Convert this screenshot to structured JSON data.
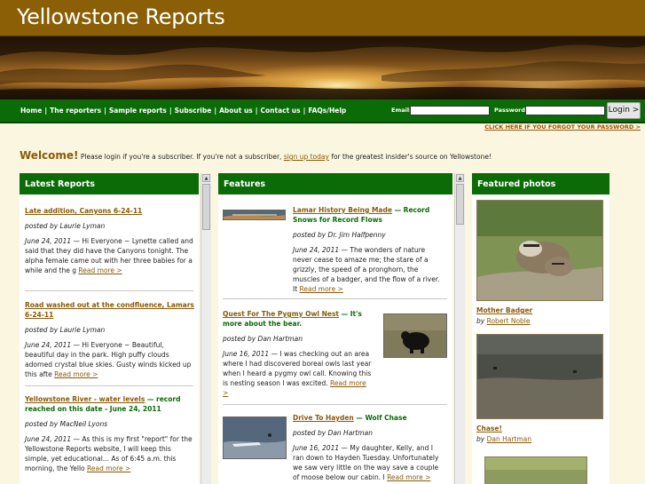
{
  "site": {
    "title": "Yellowstone Reports"
  },
  "nav": {
    "items": [
      "Home",
      "The reporters",
      "Sample reports",
      "Subscribe",
      "About us",
      "Contact us",
      "FAQs/Help"
    ],
    "separator": "|"
  },
  "login": {
    "email_label": "Email:",
    "password_label": "Password:",
    "email_value": "",
    "password_value": "",
    "button_label": "Login >",
    "forgot_link": "CLICK HERE IF YOU FORGOT YOUR PASSWORD >"
  },
  "welcome": {
    "heading": "Welcome!",
    "text_before": " Please login if you're a subscriber. If you're not a subscriber, ",
    "link": "sign up today",
    "text_after": " for the greatest insider's source on Yellowstone!"
  },
  "latest_reports": {
    "heading": "Latest Reports",
    "read_more": "Read more >",
    "items": [
      {
        "title": "Late addition, Canyons 6-24-11",
        "subtitle": "",
        "by": "posted by Laurie Lyman",
        "date": "June 24, 2011",
        "text": " — Hi Everyone ~ Lynette called and said that they did have the Canyons tonight. The alpha female came out with her three babies for a while and the g "
      },
      {
        "title": "Road washed out at the condfluence, Lamars 6-24-11",
        "subtitle": "",
        "by": "posted by Laurie Lyman",
        "date": "June 24, 2011",
        "text": " — Hi Everyone ~  Beautiful, beautiful day in the park.  High puffy clouds adorned crystal blue skies.  Gusty winds kicked up this afte "
      },
      {
        "title": "Yellowstone River - water levels",
        "subtitle": " — record reached on this date - June 24, 2011",
        "by": "posted by MacNeil Lyons",
        "date": "June 24, 2011",
        "text": " — As this is my first \"report\" for the Yellowstone Reports website, I will keep this simple, yet educational... As of 6:45 a.m. this morning, the Yello "
      }
    ]
  },
  "features": {
    "heading": "Features",
    "read_more": "Read more >",
    "items": [
      {
        "title": "Lamar History Being Made",
        "subtitle": " — Record Snows for Record Flows",
        "by": "posted by Dr. Jim Halfpenny",
        "date": "June 24, 2011",
        "text": " — The wonders of nature never cease to amaze me; the stare of a grizzly, the speed of a pronghorn, the muscles of a badger, and the flow of a river. It "
      },
      {
        "title": "Quest For The Pygmy Owl Nest",
        "subtitle": " — It's more about the bear.",
        "by": "posted by Dan Hartman",
        "date": "June 16, 2011",
        "text": " — I was checking out an area where I had discovered boreal owls last year when I heard a pygmy owl call. Knowing this is nesting season I was excited. "
      },
      {
        "title": "Drive To Hayden",
        "subtitle": " — Wolf Chase",
        "by": "posted by Dan Hartman",
        "date": "June 16, 2011",
        "text": " — My daughter, Kelly, and I ran down to Hayden Tuesday. Unfortunately we saw very little on the way save a couple of moose below our cabin. I "
      }
    ]
  },
  "featured_photos": {
    "heading": "Featured photos",
    "items": [
      {
        "caption": "Mother Badger",
        "by_prefix": "by ",
        "by": "Robert Noble"
      },
      {
        "caption": "Chase!",
        "by_prefix": "by ",
        "by": "Dan Hartman"
      }
    ]
  },
  "colors": {
    "header_bg": "#8a5f06",
    "nav_bg": "#0b6b07",
    "page_bg": "#fbf6df",
    "link_brown": "#8a5a08",
    "accent_green": "#0b6b07"
  },
  "icons": [
    "scroll-up-arrow-icon",
    "scroll-down-arrow-icon"
  ]
}
